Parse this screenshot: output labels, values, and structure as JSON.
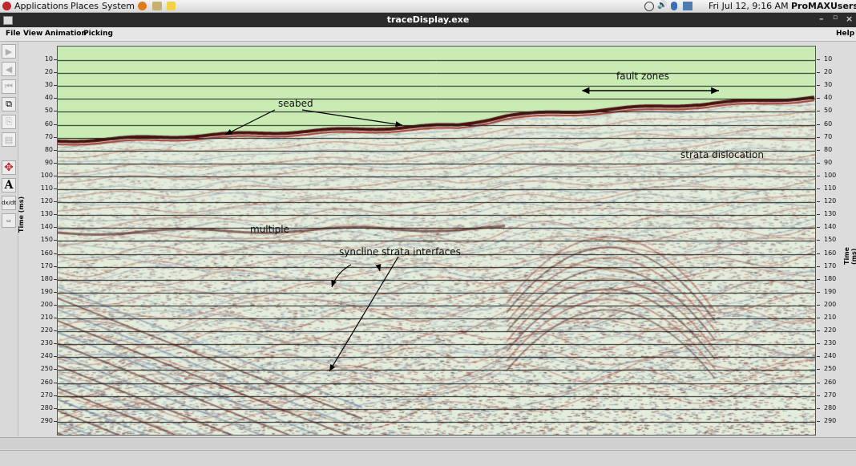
{
  "panel": {
    "menus": [
      "Applications",
      "Places",
      "System"
    ],
    "datetime": "Fri Jul 12,  9:16 AM",
    "user": "ProMAXUsers"
  },
  "window": {
    "title": "traceDisplay.exe",
    "menus": [
      "File",
      "View",
      "Animation",
      "Picking"
    ],
    "help": "Help"
  },
  "toolbar": {
    "icons": [
      "play-next-icon",
      "play-prev-icon",
      "rewind-icon",
      "zoom-windows-icon",
      "disabled-copy-icon",
      "disabled-doc-icon",
      "move-cross-icon",
      "text-annotation-icon",
      "dx-dt-icon",
      "memo-icon"
    ]
  },
  "axis": {
    "label": "Time (ms)",
    "ticks": [
      "10",
      "20",
      "30",
      "40",
      "50",
      "60",
      "70",
      "80",
      "90",
      "100",
      "110",
      "120",
      "130",
      "140",
      "150",
      "160",
      "170",
      "180",
      "190",
      "200",
      "210",
      "220",
      "230",
      "240",
      "250",
      "260",
      "270",
      "280",
      "290"
    ]
  },
  "annotations": {
    "seabed": "seabed",
    "fault_zones": "fault zones",
    "strata_dislocation": "strata dislocation",
    "multiple": "multiple",
    "syncline": "syncline strata interfaces"
  },
  "colors": {
    "water": "#c9ecb4",
    "seismic_bg": "#e4ecdc",
    "reflector_dark": "#4a1010",
    "reflector_red": "#a23b2d",
    "trough_blue": "#6c86a8"
  }
}
